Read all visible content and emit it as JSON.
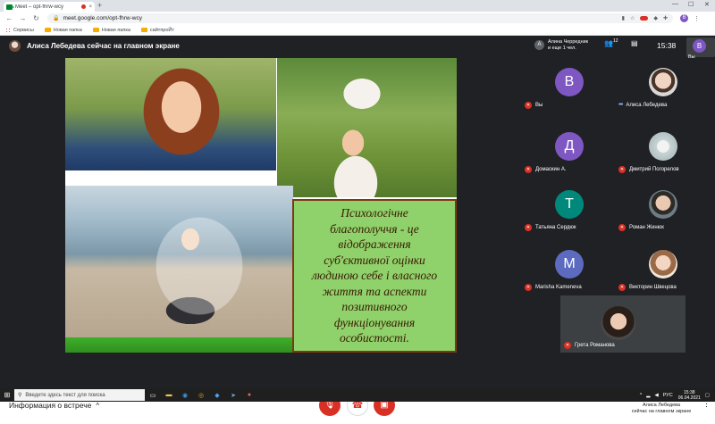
{
  "browser": {
    "tab_title": "Meet – opt-fhrw-wcy",
    "tab_close": "×",
    "new_tab": "+",
    "win_min": "—",
    "win_max": "☐",
    "win_close": "✕",
    "back": "←",
    "forward": "→",
    "reload": "↻",
    "url": "meet.google.com/opt-fhrw-wcy",
    "profile_initial": "В",
    "bookmarks": [
      {
        "label": "Сервисы"
      },
      {
        "label": "Новая папка"
      },
      {
        "label": "Новая папка"
      },
      {
        "label": "сайтпроЙт"
      }
    ]
  },
  "meet": {
    "presenter_title": "Алиса Лебедева сейчас на главном экране",
    "attendee_initial": "А",
    "attendee_line1": "Алина Черредник",
    "attendee_line2": "и еще 1 чел.",
    "people_count": "12",
    "time": "15:38",
    "self_initial": "В",
    "self_label": "Вы",
    "slide_text": "Психологічне\nблагополуччя - це\nвідображення\nсуб'єктивної оцінки\nлюдиною себе і власного\nжиття та  аспекти\nпозитивного\nфункціонування\nособистості.",
    "participants": [
      {
        "name": "Вы",
        "initial": "В",
        "color": "#7e57c2",
        "status": "muted"
      },
      {
        "name": "Алиса Лебедева",
        "initial": "",
        "color": "",
        "status": "speaking"
      },
      {
        "name": "Домаскин А.",
        "initial": "Д",
        "color": "#7e57c2",
        "status": "muted"
      },
      {
        "name": "Дмитрий Погорелов",
        "initial": "",
        "color": "",
        "status": "muted"
      },
      {
        "name": "Татьяна Сердюк",
        "initial": "Т",
        "color": "#00897b",
        "status": "muted"
      },
      {
        "name": "Роман Жинюк",
        "initial": "",
        "color": "",
        "status": "muted"
      },
      {
        "name": "Marisha Kameneva",
        "initial": "М",
        "color": "#5c6bc0",
        "status": "muted"
      },
      {
        "name": "Викторин Швецова",
        "initial": "",
        "color": "",
        "status": "muted"
      }
    ],
    "last_participant": {
      "name": "Грета Романова",
      "status": "muted"
    },
    "meeting_info_label": "Информация о встрече",
    "chevron": "^",
    "present_line1": "Алиса Лебедева",
    "present_line2": "сейчас на главном экране",
    "colors": {
      "danger": "#d93025",
      "bg": "#202124",
      "slide_green": "#8fd16a"
    }
  },
  "taskbar": {
    "search_placeholder": "Введите здесь текст для поиска",
    "lang": "РУС",
    "time": "15:38",
    "date": "06.04.2021"
  }
}
